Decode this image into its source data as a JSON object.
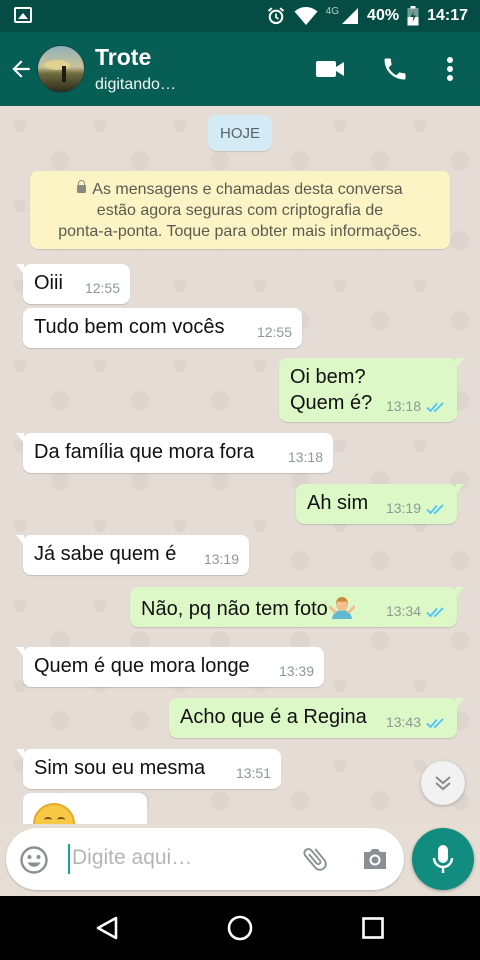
{
  "status_bar": {
    "network": "4G",
    "battery": "40%",
    "time": "14:17"
  },
  "header": {
    "contact_name": "Trote",
    "status": "digitando…",
    "icons": [
      "back-arrow-icon",
      "video-call-icon",
      "phone-icon",
      "more-options-icon"
    ]
  },
  "chat": {
    "date_label": "HOJE",
    "encryption_notice": {
      "line1": "As mensagens e chamadas desta conversa",
      "line2": "estão agora seguras com criptografia de",
      "line3": "ponta-a-ponta. Toque para obter mais informações."
    },
    "messages": [
      {
        "direction": "in",
        "text": "Oiii",
        "time": "12:55"
      },
      {
        "direction": "in",
        "text": "Tudo bem com vocês",
        "time": "12:55"
      },
      {
        "direction": "out",
        "line1": "Oi bem?",
        "line2": "Quem é?",
        "time": "13:18",
        "status": "read"
      },
      {
        "direction": "in",
        "text": "Da família que mora fora",
        "time": "13:18"
      },
      {
        "direction": "out",
        "text": "Ah sim",
        "time": "13:19",
        "status": "read"
      },
      {
        "direction": "in",
        "text": "Já sabe quem é",
        "time": "13:19"
      },
      {
        "direction": "out",
        "text": "Não, pq não tem foto",
        "emoji": "person-shrugging-emoji",
        "time": "13:34",
        "status": "read"
      },
      {
        "direction": "in",
        "text": "Quem é que mora longe",
        "time": "13:39"
      },
      {
        "direction": "out",
        "text": "Acho que é a Regina",
        "time": "13:43",
        "status": "read"
      },
      {
        "direction": "in",
        "text": "Sim sou eu mesma",
        "time": "13:51"
      },
      {
        "direction": "in",
        "emoji": "smiling-face-emoji"
      }
    ]
  },
  "input": {
    "placeholder": "Digite aqui…"
  },
  "colors": {
    "header": "#075e54",
    "status_bar": "#054d44",
    "outgoing_bubble": "#dcf8c6",
    "incoming_bubble": "#ffffff",
    "read_ticks": "#4fc3f7",
    "accent": "#128c7e",
    "chat_background": "#e5ddd5"
  }
}
